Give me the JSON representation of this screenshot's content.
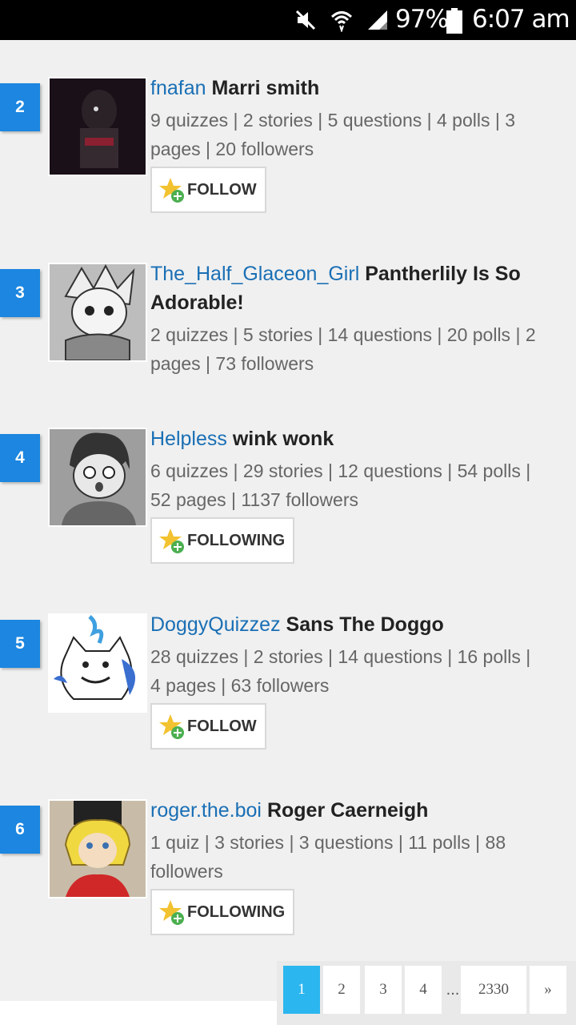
{
  "status_bar": {
    "battery_percent": "97%",
    "time": "6:07 am",
    "icons": [
      "mute-icon",
      "wifi-icon",
      "signal-icon",
      "battery-icon"
    ]
  },
  "entries": [
    {
      "rank": "2",
      "username": "fnafan",
      "display_name": "Marri smith",
      "stats_line1": "9 quizzes | 2 stories | 5 questions | 4 polls | 3",
      "stats_line2": "pages | 20 followers",
      "button": "FOLLOW"
    },
    {
      "rank": "3",
      "username": "The_Half_Glaceon_Girl",
      "display_name": "Pantherlily Is So",
      "display_name_line2": "Adorable!",
      "stats_line1": "2 quizzes | 5 stories | 14 questions | 20 polls | 2",
      "stats_line2": "pages | 73 followers"
    },
    {
      "rank": "4",
      "username": "Helpless",
      "display_name": "wink wonk",
      "stats_line1": "6 quizzes | 29 stories | 12 questions | 54 polls |",
      "stats_line2": "52 pages | 1137 followers",
      "button": "FOLLOWING"
    },
    {
      "rank": "5",
      "username": "DoggyQuizzez",
      "display_name": "Sans The Doggo",
      "stats_line1": "28 quizzes | 2 stories | 14 questions | 16 polls |",
      "stats_line2": "4 pages | 63 followers",
      "button": "FOLLOW"
    },
    {
      "rank": "6",
      "username": "roger.the.boi",
      "display_name": "Roger Caerneigh",
      "stats_line1": "1 quiz | 3 stories | 3 questions | 11 polls | 88",
      "stats_line2": "followers",
      "button": "FOLLOWING"
    }
  ],
  "pagination": {
    "pages": [
      "1",
      "2",
      "3",
      "4",
      "2330"
    ],
    "ellipsis": "...",
    "next": "»",
    "active": "1"
  },
  "colors": {
    "rank_badge": "#1c86e0",
    "username_link": "#1a6fb5",
    "active_page": "#2cb6ef"
  }
}
